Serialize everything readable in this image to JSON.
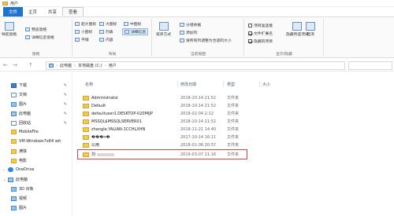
{
  "window": {
    "title": "用户"
  },
  "tabs": {
    "file": "文件",
    "home": "主页",
    "share": "共享",
    "view": "查看"
  },
  "ribbon": {
    "pane": {
      "nav_pane": "导航窗格",
      "preview": "预览窗格",
      "details": "详细信息窗格",
      "label": "窗格"
    },
    "layout": {
      "xl_icons": "超大图标",
      "l_icons": "大图标",
      "m_icons": "中图标",
      "s_icons": "小图标",
      "list": "列表",
      "details": "详细信息",
      "tiles": "平铺",
      "content": "内容",
      "label": "布局"
    },
    "current_view": {
      "sort": "排序方式",
      "group": "分组依据",
      "add_col": "添加列",
      "fit_cols": "将所有列调整为合适的大小",
      "label": "当前视图"
    },
    "show_hide": {
      "item_checkbox": "项目复选框",
      "file_ext": "文件扩展名",
      "hidden_items": "隐藏的项目",
      "hide_selected": "隐藏所选项目",
      "options": "选项",
      "label": "显示/隐藏",
      "item_checkbox_checked": false,
      "file_ext_checked": true,
      "hidden_items_checked": true
    }
  },
  "address": {
    "back": "←",
    "forward": "→",
    "up": "↑",
    "crumbs": [
      "此电脑",
      "本地磁盘 (C:)",
      "用户"
    ],
    "search_placeholder": ""
  },
  "nav": {
    "items": [
      {
        "label": "下载"
      },
      {
        "label": "文档"
      },
      {
        "label": "图片"
      },
      {
        "label": "此电脑"
      },
      {
        "label": "回收站"
      },
      {
        "label": "MobileFile"
      },
      {
        "label": "VM-Windows7x64 wit"
      },
      {
        "label": "满铁"
      },
      {
        "label": "电影"
      },
      {
        "label": "OneDrive"
      },
      {
        "label": "此电脑"
      },
      {
        "label": "3D 对象"
      },
      {
        "label": "视频"
      },
      {
        "label": "图片"
      }
    ]
  },
  "list": {
    "columns": {
      "name": "名称",
      "date": "修改日期",
      "type": "类型",
      "size": "大小"
    },
    "rows": [
      {
        "name": "Administrator",
        "date": "2018-10-14 21:52",
        "type": "文件夹"
      },
      {
        "name": "Default",
        "date": "2018-10-14 21:52",
        "type": "文件夹"
      },
      {
        "name": "defaultuser1.DESKTOP-020MIJP",
        "date": "2018-02-04 2:12",
        "type": "文件夹"
      },
      {
        "name": "MSSQL$MSSQLSERVER01",
        "date": "2018-10-14 21:52",
        "type": "文件夹"
      },
      {
        "name": "zhangle.YALIAN-1CCHLXHN",
        "date": "2018-11-21 14:40",
        "type": "文件夹"
      },
      {
        "name": "���n�",
        "date": "2017-10-14 16:11",
        "type": "文件夹"
      },
      {
        "name": "公用",
        "date": "2018-01-06 20:57",
        "type": "文件夹"
      },
      {
        "name": "刘",
        "date": "2019-03-07 21:16",
        "type": "文件夹"
      }
    ]
  },
  "colors": {
    "accent": "#1e73d0",
    "highlight": "#e0433e"
  }
}
